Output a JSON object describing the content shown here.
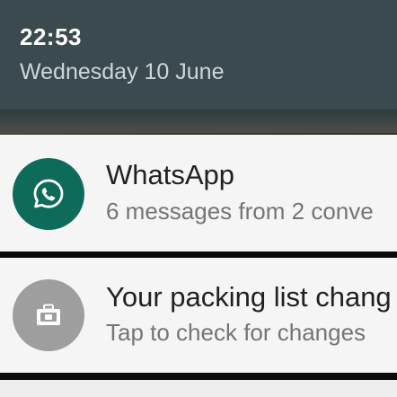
{
  "status": {
    "time": "22:53",
    "date": "Wednesday 10 June"
  },
  "notifications": [
    {
      "app_icon": "whatsapp-icon",
      "title": "WhatsApp",
      "text": "6 messages from 2 conve",
      "icon_bg": "#0e6b5a"
    },
    {
      "app_icon": "suitcase-icon",
      "title": "Your packing list chang",
      "text": "Tap to check for changes",
      "icon_bg": "#9e9e9e"
    }
  ]
}
